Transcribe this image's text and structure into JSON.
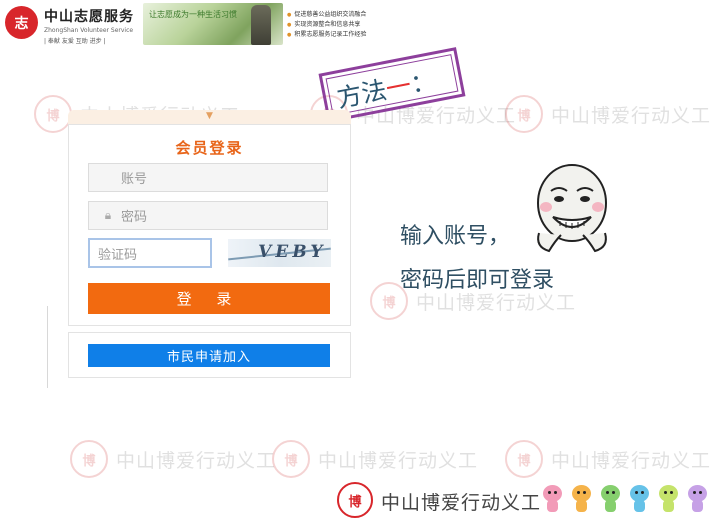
{
  "header": {
    "logo_glyph": "志",
    "brand_cn": "中山志愿服务",
    "brand_en": "ZhongShan Volunteer Service",
    "slogan": "| 奉献   友爱   互助   进步 |",
    "banner_text": "让志愿成为一种生活习惯",
    "bullets": [
      "促进慈善公益组织交流融合",
      "实现资源整合和信息共享",
      "积累志愿服务记录工作经验"
    ]
  },
  "stamp": {
    "text": "方法",
    "dash": "一",
    "suffix": "："
  },
  "login": {
    "title": "会员登录",
    "username_placeholder": "账号",
    "password_placeholder": "密码",
    "captcha_placeholder": "验证码",
    "captcha_text": "VEBY",
    "login_button": "登 录",
    "join_button": "市民申请加入"
  },
  "instructions": {
    "line1": "输入账号，",
    "line2": "密码后即可登录"
  },
  "watermark": {
    "text": "中山博爱行动义工",
    "seal_glyph": "博"
  },
  "footer": {
    "seal_glyph": "博",
    "text": "中山博爱行动义工"
  },
  "colors": {
    "accent_orange": "#f26a10",
    "join_blue": "#0f7fe8",
    "stamp_purple": "#8d3f9c",
    "brand_red": "#d8262b"
  },
  "mascot_colors": [
    "#f29bb8",
    "#f5b34a",
    "#86cf6e",
    "#66c2e8",
    "#c5e36b",
    "#c6a1e6"
  ]
}
